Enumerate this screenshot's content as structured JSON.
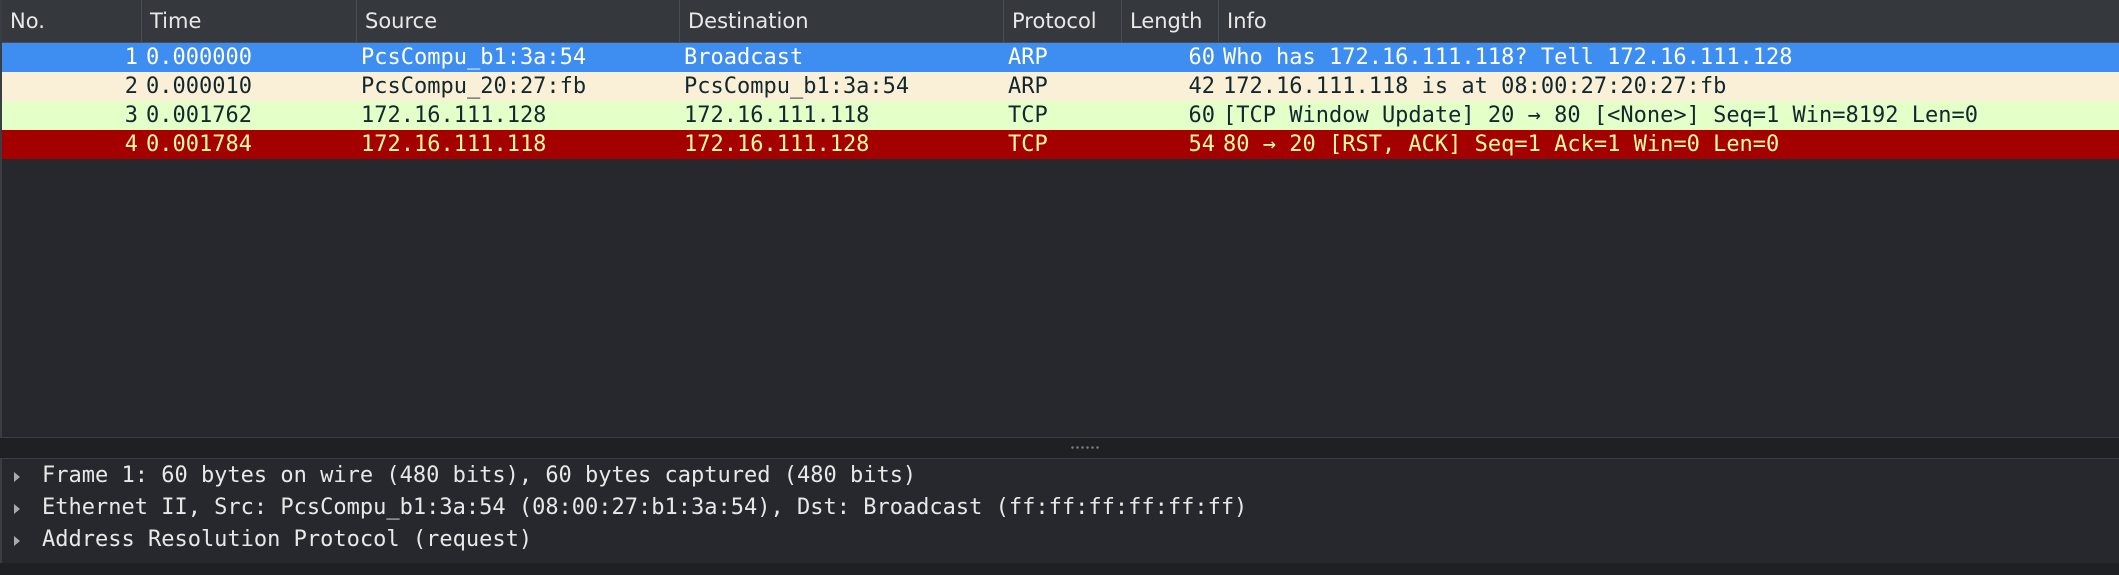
{
  "columns": {
    "no": "No.",
    "time": "Time",
    "source": "Source",
    "destination": "Destination",
    "protocol": "Protocol",
    "length": "Length",
    "info": "Info"
  },
  "packets": [
    {
      "no": "1",
      "time": "0.000000",
      "source": "PcsCompu_b1:3a:54",
      "destination": "Broadcast",
      "protocol": "ARP",
      "length": "60",
      "info": "Who has 172.16.111.118? Tell 172.16.111.128",
      "bg": "#3d8ef0",
      "fg": "#ffffff"
    },
    {
      "no": "2",
      "time": "0.000010",
      "source": "PcsCompu_20:27:fb",
      "destination": "PcsCompu_b1:3a:54",
      "protocol": "ARP",
      "length": "42",
      "info": "172.16.111.118 is at 08:00:27:20:27:fb",
      "bg": "#faf0d7",
      "fg": "#12272e"
    },
    {
      "no": "3",
      "time": "0.001762",
      "source": "172.16.111.128",
      "destination": "172.16.111.118",
      "protocol": "TCP",
      "length": "60",
      "info": "[TCP Window Update] 20 → 80 [<None>] Seq=1 Win=8192 Len=0",
      "bg": "#e4ffc7",
      "fg": "#12272e"
    },
    {
      "no": "4",
      "time": "0.001784",
      "source": "172.16.111.118",
      "destination": "172.16.111.128",
      "protocol": "TCP",
      "length": "54",
      "info": "80 → 20 [RST, ACK] Seq=1 Ack=1 Win=0 Len=0",
      "bg": "#a40000",
      "fg": "#fffc9c"
    }
  ],
  "details": [
    {
      "text": "Frame 1: 60 bytes on wire (480 bits), 60 bytes captured (480 bits)",
      "icon": "expand-arrow-icon"
    },
    {
      "text": "Ethernet II, Src: PcsCompu_b1:3a:54 (08:00:27:b1:3a:54), Dst: Broadcast (ff:ff:ff:ff:ff:ff)",
      "icon": "expand-arrow-icon"
    },
    {
      "text": "Address Resolution Protocol (request)",
      "icon": "expand-arrow-icon"
    }
  ]
}
